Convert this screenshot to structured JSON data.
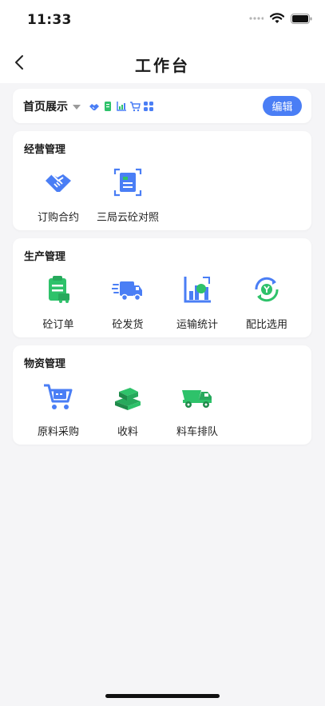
{
  "status_bar": {
    "time": "11:33"
  },
  "nav": {
    "title": "工作台"
  },
  "display": {
    "label": "首页展示",
    "edit_label": "编辑",
    "mini_icons": [
      "handshake-icon",
      "document-icon",
      "chart-icon",
      "cart-icon",
      "grid-icon"
    ]
  },
  "sections": [
    {
      "title": "经营管理",
      "items": [
        {
          "label": "订购合约",
          "icon": "handshake-icon"
        },
        {
          "label": "三局云砼对照",
          "icon": "scan-document-icon"
        }
      ]
    },
    {
      "title": "生产管理",
      "items": [
        {
          "label": "砼订单",
          "icon": "clipboard-order-icon"
        },
        {
          "label": "砼发货",
          "icon": "delivery-truck-icon"
        },
        {
          "label": "运输统计",
          "icon": "bar-chart-icon"
        },
        {
          "label": "配比选用",
          "icon": "cycle-icon"
        }
      ]
    },
    {
      "title": "物资管理",
      "items": [
        {
          "label": "原料采购",
          "icon": "shopping-cart-icon"
        },
        {
          "label": "收料",
          "icon": "materials-stack-icon"
        },
        {
          "label": "料车排队",
          "icon": "dump-truck-icon"
        }
      ]
    }
  ],
  "colors": {
    "accent": "#4a7ef5",
    "green": "#2ec26a",
    "blue": "#4a7ef5"
  }
}
